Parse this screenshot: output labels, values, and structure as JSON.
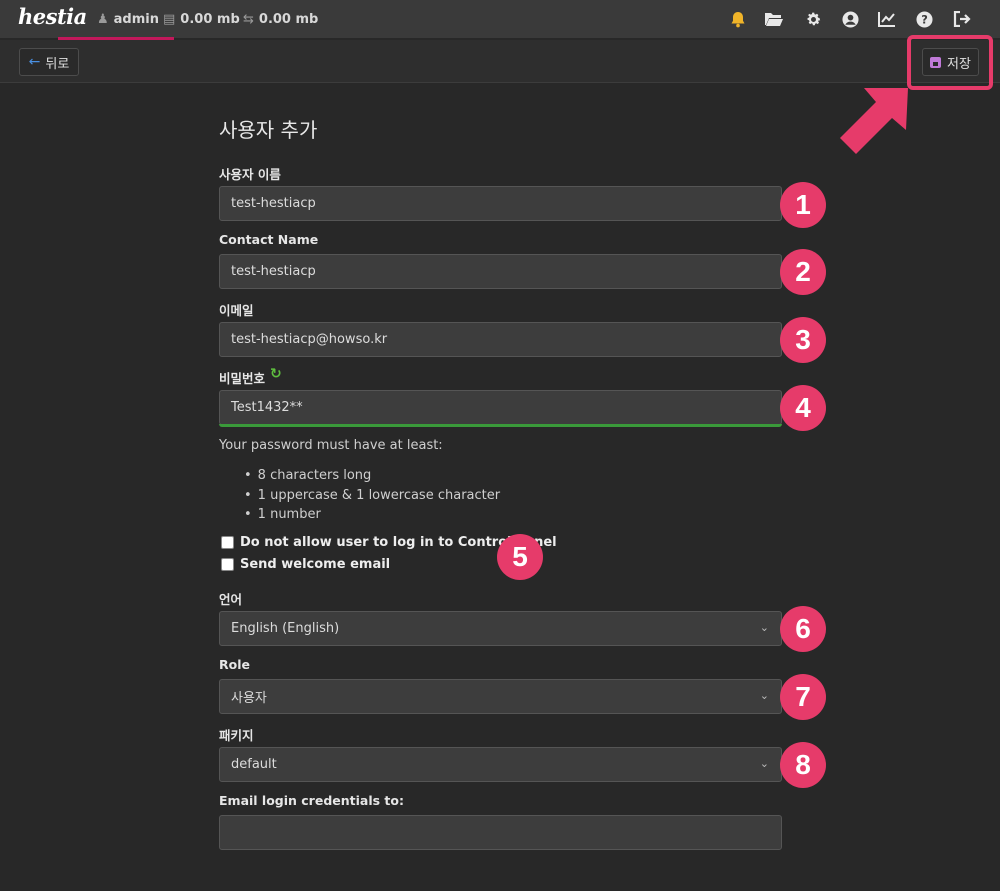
{
  "topbar": {
    "logo": "hestia",
    "user": "admin",
    "disk": "0.00 mb",
    "bandwidth": "0.00 mb"
  },
  "toolbar": {
    "back_label": "뒤로",
    "save_label": "저장"
  },
  "form": {
    "title": "사용자 추가",
    "username": {
      "label": "사용자 이름",
      "value": "test-hestiacp"
    },
    "contact_name": {
      "label": "Contact Name",
      "value": "test-hestiacp"
    },
    "email": {
      "label": "이메일",
      "value": "test-hestiacp@howso.kr"
    },
    "password": {
      "label": "비밀번호",
      "value": "Test1432**"
    },
    "password_hint": "Your password must have at least:",
    "password_rules": [
      "8 characters long",
      "1 uppercase & 1 lowercase character",
      "1 number"
    ],
    "no_login_label": "Do not allow user to log in to Control Panel",
    "welcome_email_label": "Send welcome email",
    "language": {
      "label": "언어",
      "value": "English (English)"
    },
    "role": {
      "label": "Role",
      "value": "사용자"
    },
    "package": {
      "label": "패키지",
      "value": "default"
    },
    "email_credentials": {
      "label": "Email login credentials to:",
      "value": ""
    }
  },
  "badges": [
    "1",
    "2",
    "3",
    "4",
    "5",
    "6",
    "7",
    "8"
  ],
  "colors": {
    "accent": "#e63b6a",
    "strength_bar": "#3a9a3a",
    "save_icon": "#c07ad8",
    "back_arrow": "#4a90e2"
  }
}
